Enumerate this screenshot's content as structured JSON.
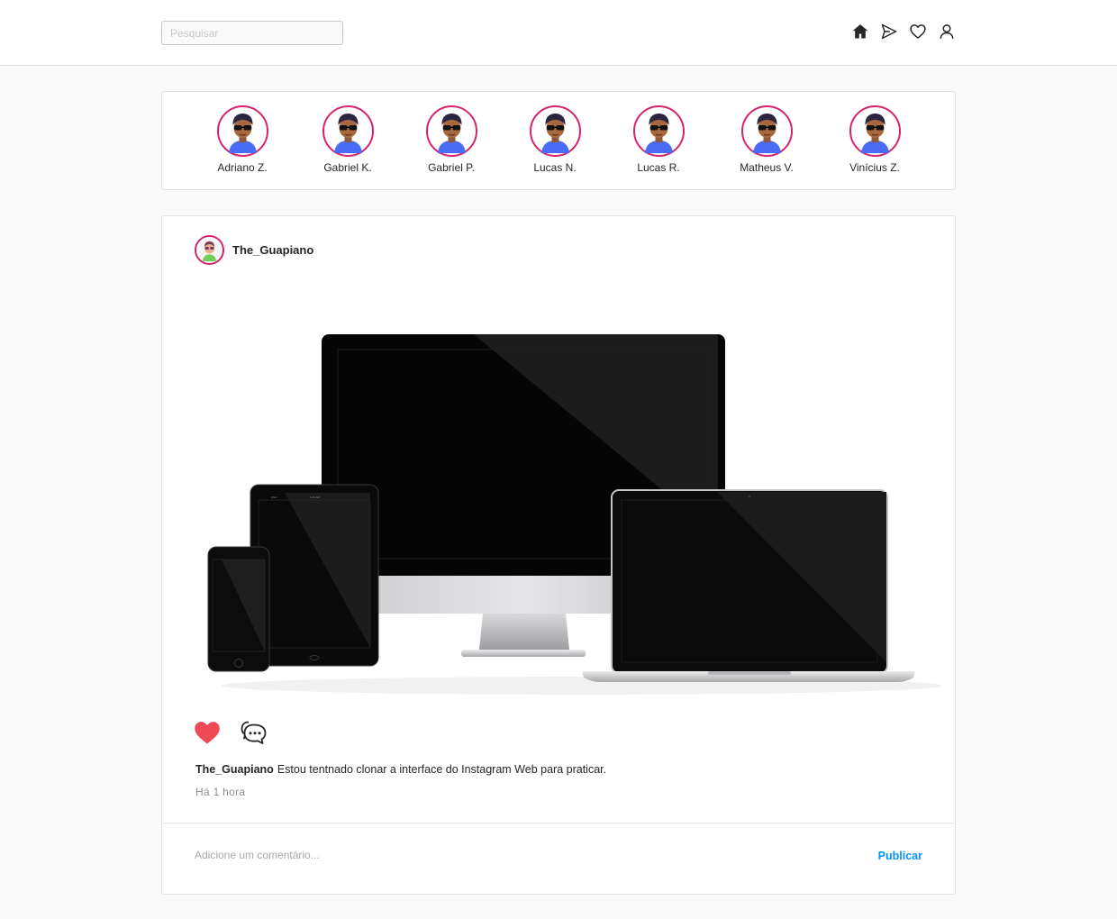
{
  "header": {
    "search_placeholder": "Pesquisar",
    "icons": [
      "home-icon",
      "direct-send-icon",
      "heart-icon",
      "profile-icon"
    ]
  },
  "stories": [
    {
      "name": "Adriano Z."
    },
    {
      "name": "Gabriel K."
    },
    {
      "name": "Gabriel P."
    },
    {
      "name": "Lucas N."
    },
    {
      "name": "Lucas R."
    },
    {
      "name": "Matheus V."
    },
    {
      "name": "Vinícius Z."
    }
  ],
  "post": {
    "username": "The_Guapiano",
    "caption_user": "The_Guapiano",
    "caption_text": "Estou tentnado clonar a interface do Instagram Web para praticar.",
    "time": "Há 1 hora",
    "liked": true,
    "comment_placeholder": "Adicione um comentário...",
    "publish_label": "Publicar"
  },
  "colors": {
    "story_ring": "#d6246e",
    "like": "#ed4956",
    "publish": "#0095f6"
  }
}
